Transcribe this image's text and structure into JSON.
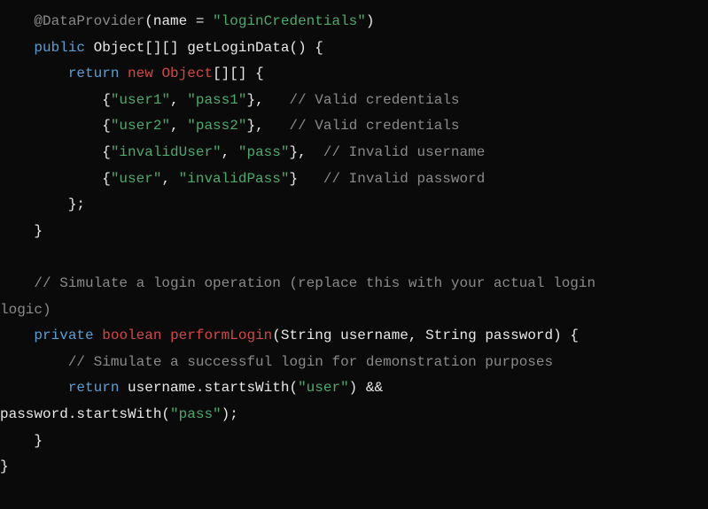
{
  "code": {
    "lines": [
      {
        "indent": "    ",
        "tokens": [
          {
            "cls": "annotation",
            "txt": "@DataProvider"
          },
          {
            "cls": "punct",
            "txt": "(name = "
          },
          {
            "cls": "string",
            "txt": "\"loginCredentials\""
          },
          {
            "cls": "punct",
            "txt": ")"
          }
        ]
      },
      {
        "indent": "    ",
        "tokens": [
          {
            "cls": "keyword",
            "txt": "public"
          },
          {
            "cls": "punct",
            "txt": " "
          },
          {
            "cls": "identifier",
            "txt": "Object[][] getLoginData() {"
          }
        ]
      },
      {
        "indent": "        ",
        "tokens": [
          {
            "cls": "keyword",
            "txt": "return"
          },
          {
            "cls": "punct",
            "txt": " "
          },
          {
            "cls": "keyword-red",
            "txt": "new"
          },
          {
            "cls": "punct",
            "txt": " "
          },
          {
            "cls": "type-red",
            "txt": "Object"
          },
          {
            "cls": "identifier",
            "txt": "[][] {"
          }
        ]
      },
      {
        "indent": "            ",
        "tokens": [
          {
            "cls": "punct",
            "txt": "{"
          },
          {
            "cls": "string",
            "txt": "\"user1\""
          },
          {
            "cls": "punct",
            "txt": ", "
          },
          {
            "cls": "string",
            "txt": "\"pass1\""
          },
          {
            "cls": "punct",
            "txt": "},   "
          },
          {
            "cls": "comment",
            "txt": "// Valid credentials"
          }
        ]
      },
      {
        "indent": "            ",
        "tokens": [
          {
            "cls": "punct",
            "txt": "{"
          },
          {
            "cls": "string",
            "txt": "\"user2\""
          },
          {
            "cls": "punct",
            "txt": ", "
          },
          {
            "cls": "string",
            "txt": "\"pass2\""
          },
          {
            "cls": "punct",
            "txt": "},   "
          },
          {
            "cls": "comment",
            "txt": "// Valid credentials"
          }
        ]
      },
      {
        "indent": "            ",
        "tokens": [
          {
            "cls": "punct",
            "txt": "{"
          },
          {
            "cls": "string",
            "txt": "\"invalidUser\""
          },
          {
            "cls": "punct",
            "txt": ", "
          },
          {
            "cls": "string",
            "txt": "\"pass\""
          },
          {
            "cls": "punct",
            "txt": "},  "
          },
          {
            "cls": "comment",
            "txt": "// Invalid username"
          }
        ]
      },
      {
        "indent": "            ",
        "tokens": [
          {
            "cls": "punct",
            "txt": "{"
          },
          {
            "cls": "string",
            "txt": "\"user\""
          },
          {
            "cls": "punct",
            "txt": ", "
          },
          {
            "cls": "string",
            "txt": "\"invalidPass\""
          },
          {
            "cls": "punct",
            "txt": "}   "
          },
          {
            "cls": "comment",
            "txt": "// Invalid password"
          }
        ]
      },
      {
        "indent": "        ",
        "tokens": [
          {
            "cls": "punct",
            "txt": "};"
          }
        ]
      },
      {
        "indent": "    ",
        "tokens": [
          {
            "cls": "punct",
            "txt": "}"
          }
        ]
      },
      {
        "indent": "",
        "tokens": [
          {
            "cls": "punct",
            "txt": " "
          }
        ]
      },
      {
        "indent": "    ",
        "tokens": [
          {
            "cls": "comment",
            "txt": "// Simulate a login operation (replace this with your actual login "
          }
        ]
      },
      {
        "indent": "",
        "tokens": [
          {
            "cls": "comment",
            "txt": "logic)"
          }
        ]
      },
      {
        "indent": "    ",
        "tokens": [
          {
            "cls": "keyword",
            "txt": "private"
          },
          {
            "cls": "punct",
            "txt": " "
          },
          {
            "cls": "keyword-red",
            "txt": "boolean"
          },
          {
            "cls": "punct",
            "txt": " "
          },
          {
            "cls": "method-red",
            "txt": "performLogin"
          },
          {
            "cls": "identifier",
            "txt": "(String username, String password) {"
          }
        ]
      },
      {
        "indent": "        ",
        "tokens": [
          {
            "cls": "comment",
            "txt": "// Simulate a successful login for demonstration purposes"
          }
        ]
      },
      {
        "indent": "        ",
        "tokens": [
          {
            "cls": "keyword",
            "txt": "return"
          },
          {
            "cls": "identifier",
            "txt": " username.startsWith("
          },
          {
            "cls": "string",
            "txt": "\"user\""
          },
          {
            "cls": "identifier",
            "txt": ") && "
          }
        ]
      },
      {
        "indent": "",
        "tokens": [
          {
            "cls": "identifier",
            "txt": "password.startsWith("
          },
          {
            "cls": "string",
            "txt": "\"pass\""
          },
          {
            "cls": "identifier",
            "txt": ");"
          }
        ]
      },
      {
        "indent": "    ",
        "tokens": [
          {
            "cls": "punct",
            "txt": "}"
          }
        ]
      },
      {
        "indent": "",
        "tokens": [
          {
            "cls": "punct",
            "txt": "}"
          }
        ]
      }
    ]
  }
}
